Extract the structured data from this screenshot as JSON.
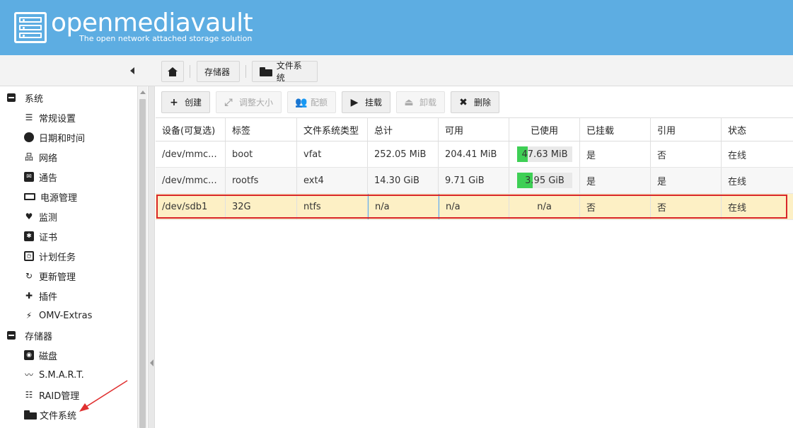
{
  "header": {
    "title": "openmediavault",
    "subtitle": "The open network attached storage solution"
  },
  "breadcrumb": {
    "items": [
      "存储器",
      "文件系统"
    ]
  },
  "sidebar": {
    "groups": [
      {
        "label": "系统"
      },
      {
        "label": "存储器"
      }
    ],
    "items": [
      {
        "label": "常规设置",
        "icon": "sliders-icon"
      },
      {
        "label": "日期和时间",
        "icon": "clock-icon"
      },
      {
        "label": "网络",
        "icon": "network-icon"
      },
      {
        "label": "通告",
        "icon": "envelope-icon"
      },
      {
        "label": "电源管理",
        "icon": "battery-icon"
      },
      {
        "label": "监测",
        "icon": "heartbeat-icon"
      },
      {
        "label": "证书",
        "icon": "certificate-icon"
      },
      {
        "label": "计划任务",
        "icon": "calendar-icon"
      },
      {
        "label": "更新管理",
        "icon": "refresh-icon"
      },
      {
        "label": "插件",
        "icon": "puzzle-icon"
      },
      {
        "label": "OMV-Extras",
        "icon": "plug-icon"
      },
      {
        "label": "磁盘",
        "icon": "disk-icon"
      },
      {
        "label": "S.M.A.R.T.",
        "icon": "pulse-icon"
      },
      {
        "label": "RAID管理",
        "icon": "database-icon"
      },
      {
        "label": "文件系统",
        "icon": "folder-icon"
      }
    ]
  },
  "toolbar": {
    "create": "创建",
    "resize": "调整大小",
    "quota": "配额",
    "mount": "挂载",
    "unmount": "卸载",
    "delete": "删除"
  },
  "table": {
    "columns": [
      "设备(可复选)",
      "标签",
      "文件系统类型",
      "总计",
      "可用",
      "已使用",
      "已挂载",
      "引用",
      "状态"
    ],
    "rows": [
      {
        "device": "/dev/mmc...",
        "label": "boot",
        "type": "vfat",
        "total": "252.05 MiB",
        "available": "204.41 MiB",
        "used": "47.63 MiB",
        "used_fraction": 0.19,
        "mounted": "是",
        "referenced": "否",
        "status": "在线"
      },
      {
        "device": "/dev/mmc...",
        "label": "rootfs",
        "type": "ext4",
        "total": "14.30 GiB",
        "available": "9.71 GiB",
        "used": "3.95 GiB",
        "used_fraction": 0.28,
        "mounted": "是",
        "referenced": "是",
        "status": "在线"
      },
      {
        "device": "/dev/sdb1",
        "label": "32G",
        "type": "ntfs",
        "total": "n/a",
        "available": "n/a",
        "used": "n/a",
        "mounted": "否",
        "referenced": "否",
        "status": "在线"
      }
    ]
  },
  "colors": {
    "header_bg": "#5dade2",
    "usage_fill": "#3ecf55",
    "selected_row": "#fdf0c5",
    "highlight_border": "#d9262a"
  }
}
